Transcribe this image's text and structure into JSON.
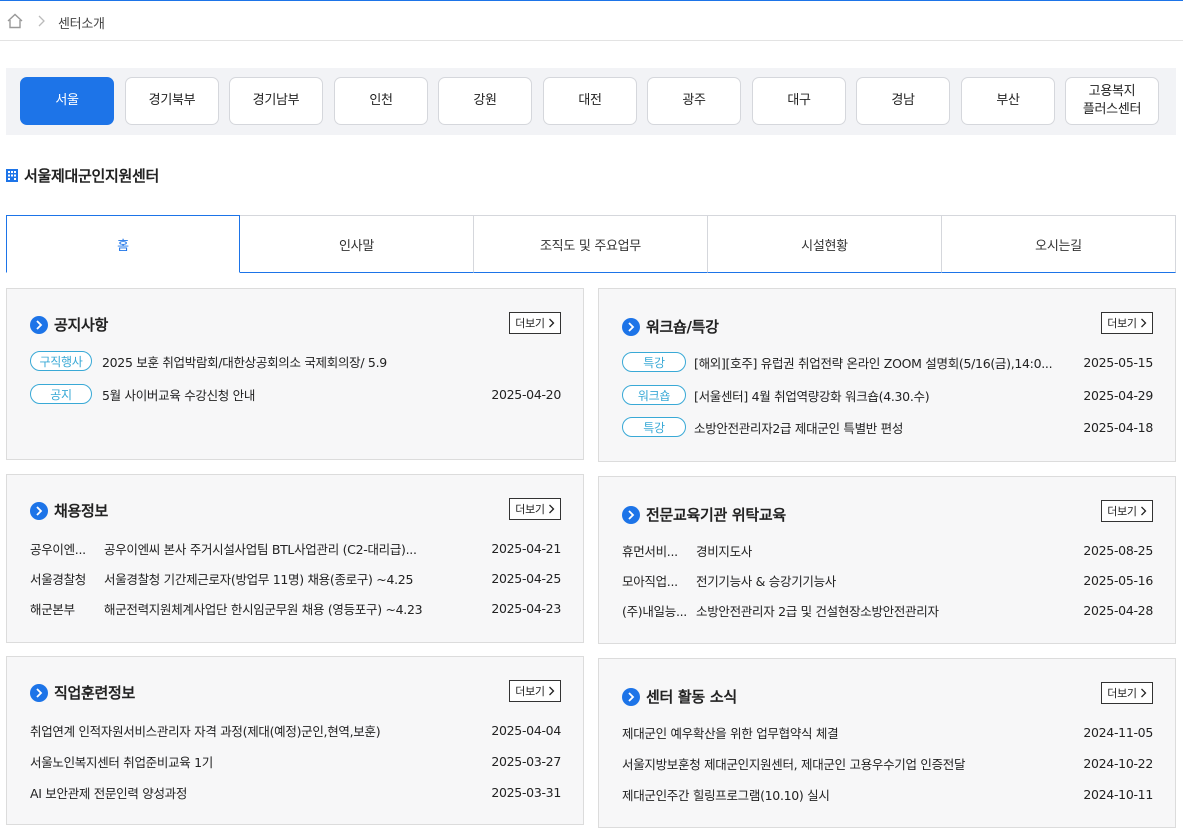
{
  "breadcrumb": {
    "current": "센터소개"
  },
  "regions": [
    {
      "label": "서울",
      "active": true
    },
    {
      "label": "경기북부"
    },
    {
      "label": "경기남부"
    },
    {
      "label": "인천"
    },
    {
      "label": "강원"
    },
    {
      "label": "대전"
    },
    {
      "label": "광주"
    },
    {
      "label": "대구"
    },
    {
      "label": "경남"
    },
    {
      "label": "부산"
    },
    {
      "label": "고용복지\n플러스센터"
    }
  ],
  "center": {
    "title": "서울제대군인지원센터"
  },
  "tabs": [
    "홈",
    "인사말",
    "조직도 및 주요업무",
    "시설현황",
    "오시는길"
  ],
  "more_label": "더보기",
  "notice": {
    "title": "공지사항",
    "items": [
      {
        "badge": "구직행사",
        "text": "2025 보훈 취업박람회/대한상공회의소 국제회의장/ 5.9",
        "date": ""
      },
      {
        "badge": "공지",
        "text": "5월 사이버교육 수강신청 안내",
        "date": "2025-04-20"
      }
    ]
  },
  "workshop": {
    "title": "워크숍/특강",
    "items": [
      {
        "badge": "특강",
        "text": "[해외][호주] 유럽권 취업전략 온라인 ZOOM 설명회(5/16(금),14:0...",
        "date": "2025-05-15"
      },
      {
        "badge": "워크숍",
        "text": "[서울센터] 4월 취업역량강화 워크숍(4.30.수)",
        "date": "2025-04-29"
      },
      {
        "badge": "특강",
        "text": "소방안전관리자2급 제대군인 특별반 편성",
        "date": "2025-04-18"
      }
    ]
  },
  "jobs": {
    "title": "채용정보",
    "items": [
      {
        "source": "공우이엔...",
        "text": "공우이엔씨 본사 주거시설사업팀 BTL사업관리 (C2-대리급)...",
        "date": "2025-04-21"
      },
      {
        "source": "서울경찰청",
        "text": "서울경찰청 기간제근로자(방업무 11명) 채용(종로구) ~4.25",
        "date": "2025-04-25"
      },
      {
        "source": "해군본부",
        "text": "해군전력지원체계사업단 한시임군무원 채용 (영등포구) ~4.23",
        "date": "2025-04-23"
      }
    ]
  },
  "edu": {
    "title": "전문교육기관 위탁교육",
    "items": [
      {
        "source": "휴먼서비...",
        "text": "경비지도사",
        "date": "2025-08-25"
      },
      {
        "source": "모아직업...",
        "text": "전기기능사 & 승강기기능사",
        "date": "2025-05-16"
      },
      {
        "source": "(주)내일능...",
        "text": "소방안전관리자 2급 및 건설현장소방안전관리자",
        "date": "2025-04-28"
      }
    ]
  },
  "training": {
    "title": "직업훈련정보",
    "items": [
      {
        "text": "취업연계 인적자원서비스관리자 자격 과정(제대(예정)군인,현역,보훈)",
        "date": "2025-04-04"
      },
      {
        "text": "서울노인복지센터 취업준비교육 1기",
        "date": "2025-03-27"
      },
      {
        "text": "AI 보안관제 전문인력 양성과정",
        "date": "2025-03-31"
      }
    ]
  },
  "activity": {
    "title": "센터 활동 소식",
    "items": [
      {
        "text": "제대군인 예우확산을 위한 업무협약식 체결",
        "date": "2024-11-05"
      },
      {
        "text": "서울지방보훈청 제대군인지원센터, 제대군인 고용우수기업 인증전달",
        "date": "2024-10-22"
      },
      {
        "text": "제대군인주간 힐링프로그램(10.10) 실시",
        "date": "2024-10-11"
      }
    ]
  }
}
